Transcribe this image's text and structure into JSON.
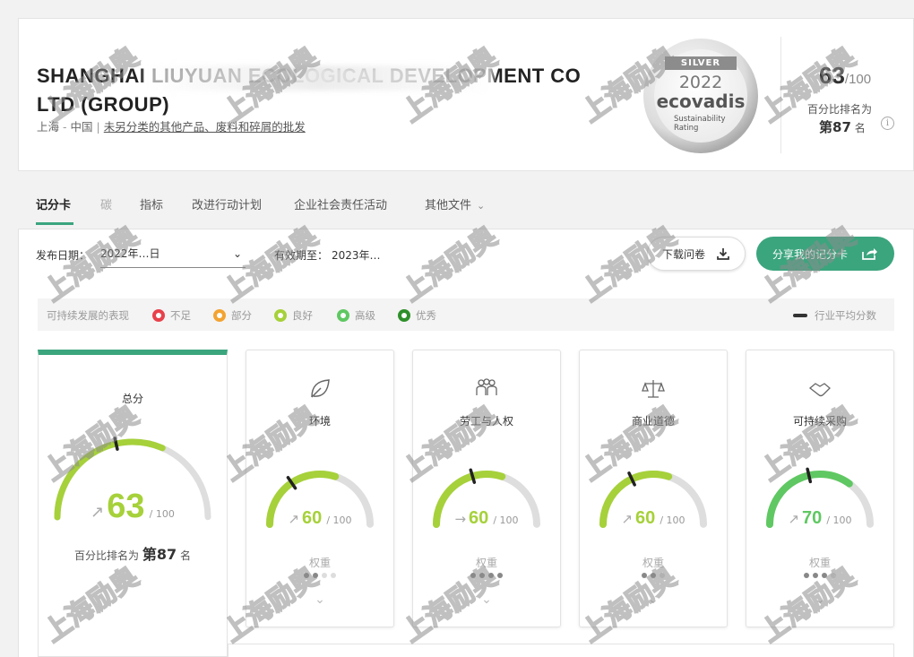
{
  "header": {
    "company_name": "SHANGHAI LIUYUAN ECOLOGICAL DEVELOPMENT CO LTD (GROUP)",
    "city": "上海",
    "country": "中国",
    "industry": "未另分类的其他产品、废料和碎屑的批发",
    "medal": {
      "ribbon": "SILVER",
      "year": "2022",
      "brand": "ecovadis",
      "sub1": "Sustainability",
      "sub2": "Rating"
    },
    "score": "63",
    "score_total": "/100",
    "rank_label": "百分比排名为",
    "rank_prefix": "第",
    "rank_value": "87",
    "rank_suffix": "名",
    "info_icon": "i"
  },
  "tabs": [
    {
      "label": "记分卡"
    },
    {
      "label": "碳"
    },
    {
      "label": "指标"
    },
    {
      "label": "改进行动计划"
    },
    {
      "label": "企业社会责任活动"
    },
    {
      "label": "其他文件"
    }
  ],
  "toolbar": {
    "pub_label": "发布日期：",
    "pub_value": "2022年…日",
    "valid_label": "有效期至：",
    "valid_value": "2023年…",
    "download_label": "下载问卷",
    "share_label": "分享我的记分卡"
  },
  "legend": {
    "title": "可持续发展的表现",
    "items": [
      {
        "label": "不足",
        "color": "#e8414b"
      },
      {
        "label": "部分",
        "color": "#f3a331"
      },
      {
        "label": "良好",
        "color": "#a6d13a"
      },
      {
        "label": "高级",
        "color": "#5fc862"
      },
      {
        "label": "优秀",
        "color": "#2f8f2a"
      }
    ],
    "avg_label": "行业平均分数"
  },
  "overall": {
    "title": "总分",
    "score": "63",
    "total": "/ 100",
    "arrow": "↗",
    "rank_label": "百分比排名为",
    "rank_prefix": "第",
    "rank_value": "87",
    "rank_suffix": "名",
    "color": "#a6d13a",
    "value_fraction": 0.63,
    "avg_fraction": 0.43
  },
  "themes": [
    {
      "title": "环境",
      "icon": "leaf-icon",
      "score": "60",
      "total": "/ 100",
      "arrow": "↗",
      "weight_label": "权重",
      "color": "#a6d13a",
      "value_fraction": 0.6,
      "avg_fraction": 0.31
    },
    {
      "title": "劳工与人权",
      "icon": "people-icon",
      "score": "60",
      "total": "/ 100",
      "arrow": "→",
      "weight_label": "权重",
      "color": "#a6d13a",
      "value_fraction": 0.6,
      "avg_fraction": 0.41
    },
    {
      "title": "商业道德",
      "icon": "scales-icon",
      "score": "60",
      "total": "/ 100",
      "arrow": "↗",
      "weight_label": "权重",
      "color": "#a6d13a",
      "value_fraction": 0.6,
      "avg_fraction": 0.36
    },
    {
      "title": "可持续采购",
      "icon": "handshake-icon",
      "score": "70",
      "total": "/ 100",
      "arrow": "↗",
      "weight_label": "权重",
      "color": "#5fc862",
      "value_fraction": 0.7,
      "avg_fraction": 0.43
    }
  ],
  "watermark": "上海励奥"
}
